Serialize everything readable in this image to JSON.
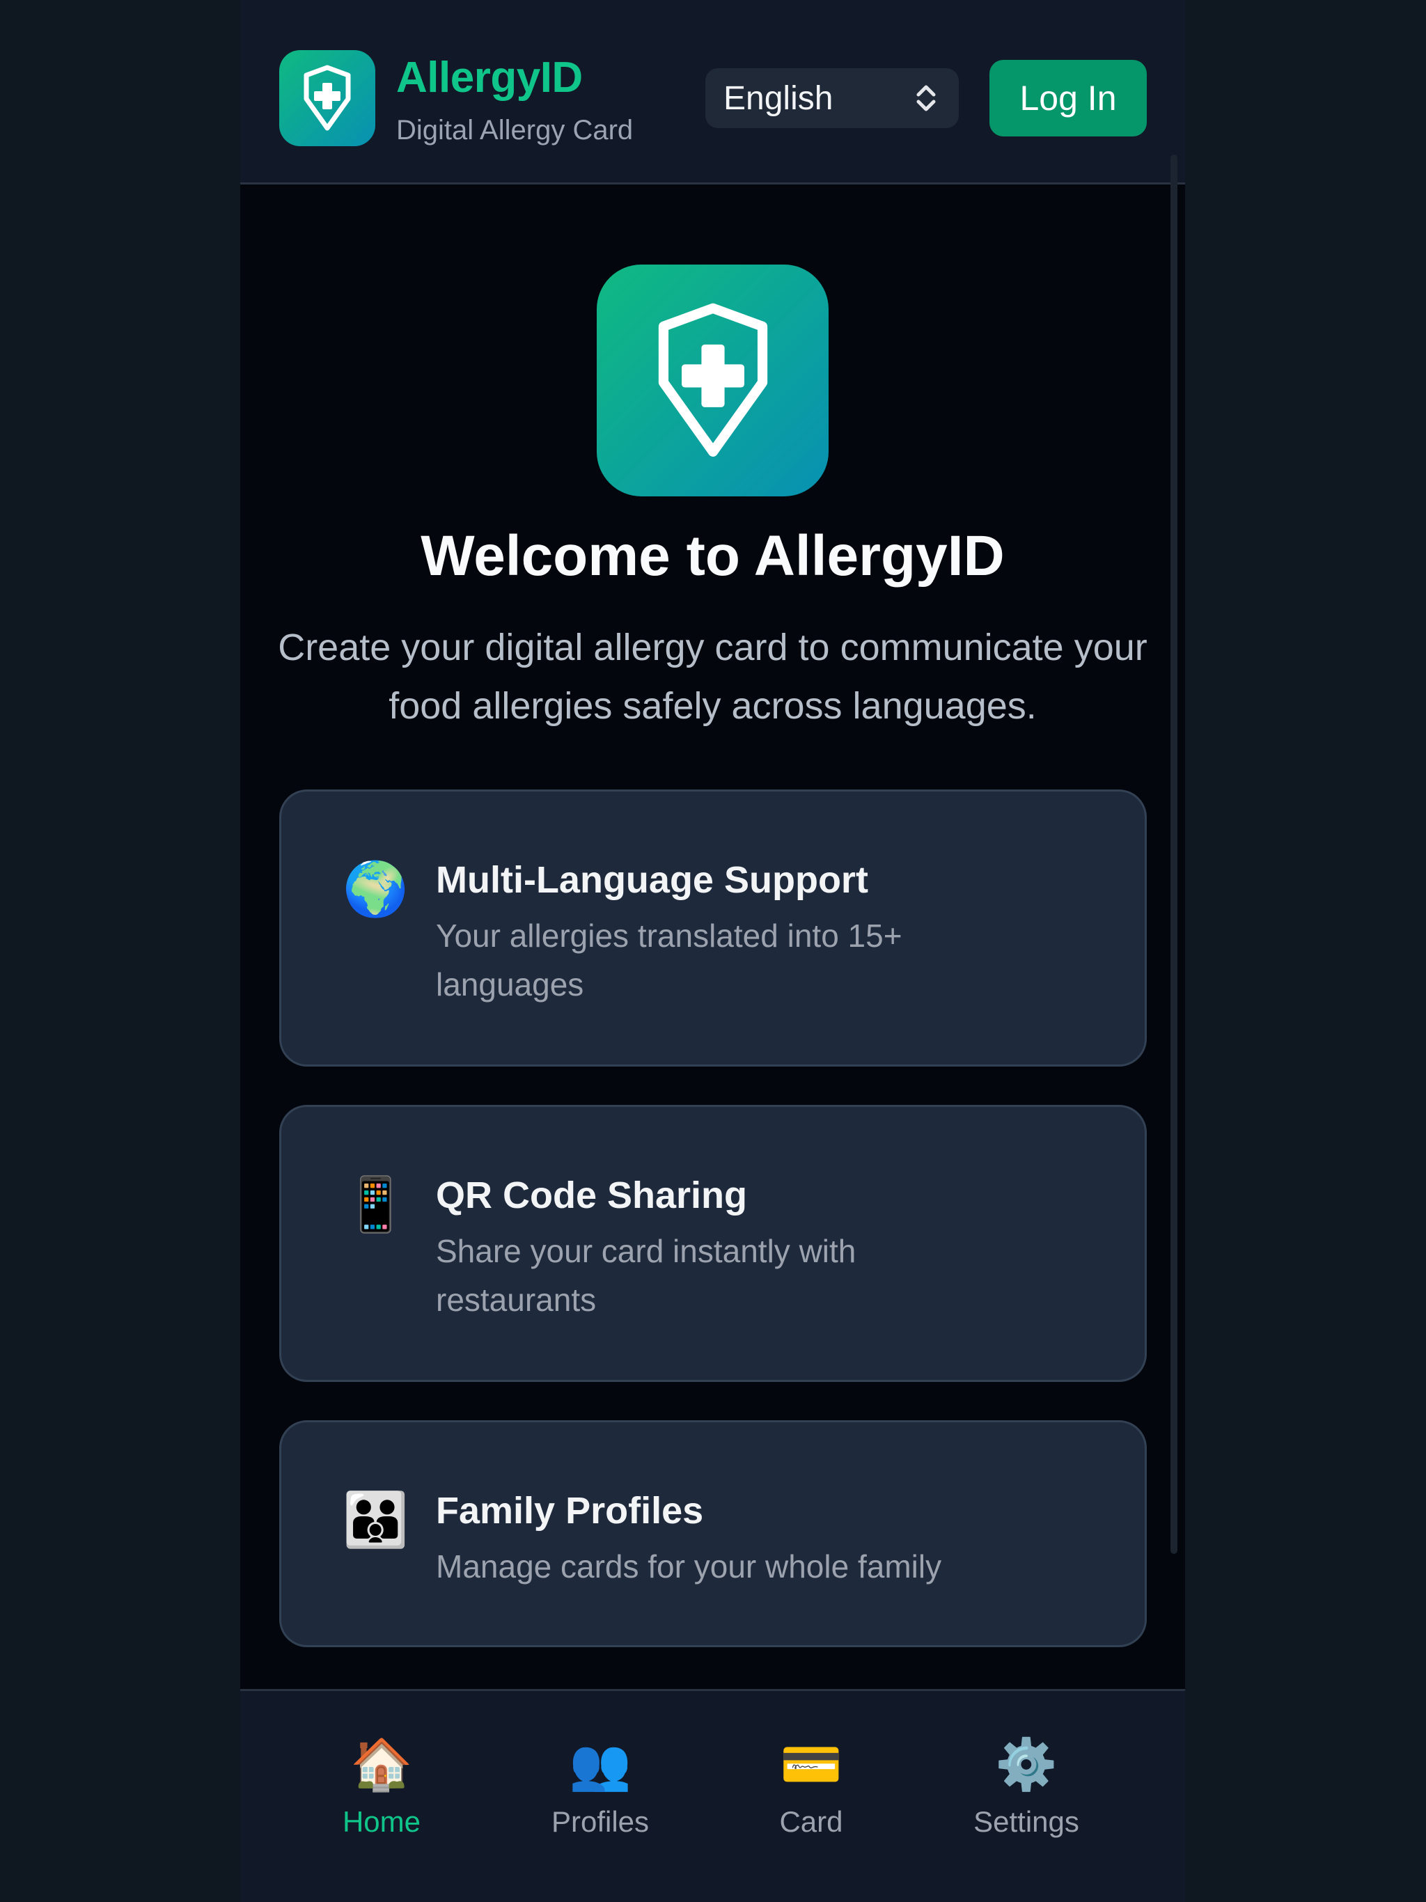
{
  "header": {
    "brand_name": "AllergyID",
    "brand_subtitle": "Digital Allergy Card",
    "language": "English",
    "login_label": "Log In"
  },
  "hero": {
    "title": "Welcome to AllergyID",
    "description": "Create your digital allergy card to communicate your food allergies safely across languages."
  },
  "features": [
    {
      "icon": "globe-icon",
      "title": "Multi-Language Support",
      "description": "Your allergies translated into 15+ languages"
    },
    {
      "icon": "phone-icon",
      "title": "QR Code Sharing",
      "description": "Share your card instantly with restaurants"
    },
    {
      "icon": "family-icon",
      "title": "Family Profiles",
      "description": "Manage cards for your whole family"
    }
  ],
  "nav": [
    {
      "label": "Home",
      "icon": "house-icon",
      "active": true
    },
    {
      "label": "Profiles",
      "icon": "profiles-icon",
      "active": false
    },
    {
      "label": "Card",
      "icon": "credit-card-icon",
      "active": false
    },
    {
      "label": "Settings",
      "icon": "gear-icon",
      "active": false
    }
  ],
  "colors": {
    "accent": "#10c58a",
    "button": "#059669",
    "background": "#03060c",
    "card": "#1e293b"
  }
}
